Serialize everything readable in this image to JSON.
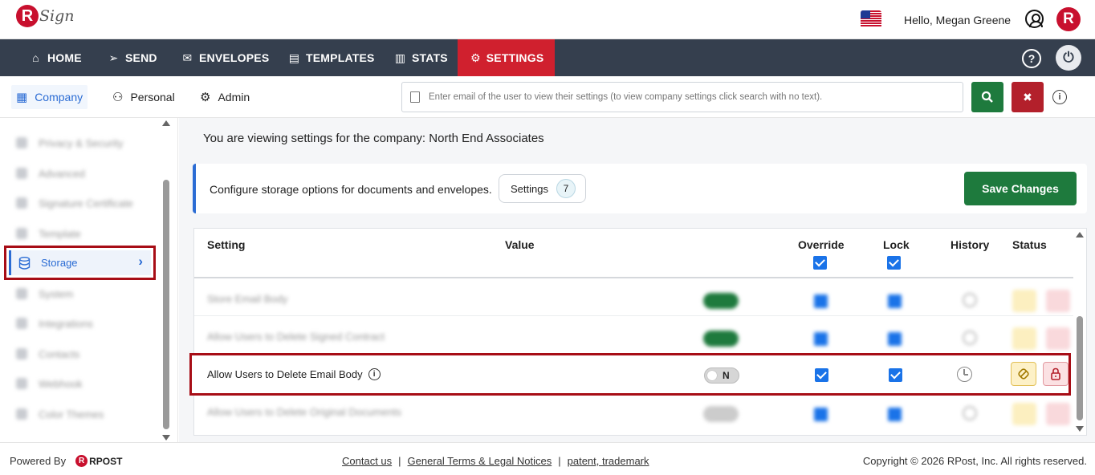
{
  "app": {
    "logo_letter": "R",
    "logo_text": "Sign"
  },
  "header": {
    "greeting": "Hello, Megan Greene",
    "brand_letter": "R"
  },
  "nav": {
    "items": [
      {
        "label": "HOME",
        "icon": "home-icon"
      },
      {
        "label": "SEND",
        "icon": "send-icon"
      },
      {
        "label": "ENVELOPES",
        "icon": "envelope-icon"
      },
      {
        "label": "TEMPLATES",
        "icon": "template-icon"
      },
      {
        "label": "STATS",
        "icon": "bar-chart-icon"
      },
      {
        "label": "SETTINGS",
        "icon": "gear-icon",
        "active": true
      }
    ],
    "help_label": "?",
    "active_color": "#d0202e",
    "bar_color": "#353f4e"
  },
  "subnav": {
    "tabs": [
      {
        "label": "Company",
        "icon": "company-icon",
        "active": true
      },
      {
        "label": "Personal",
        "icon": "person-icon"
      },
      {
        "label": "Admin",
        "icon": "admin-icon"
      }
    ],
    "search_placeholder": "Enter email of the user to view their settings (to view company settings click search with no text).",
    "search_value": ""
  },
  "sidebar": {
    "active_item": {
      "label": "Storage",
      "icon": "database-icon"
    }
  },
  "main": {
    "viewing_text": "You are viewing settings for the company: North End Associates",
    "info_text": "Configure storage options for documents and envelopes.",
    "settings_pill_label": "Settings",
    "settings_count": "7",
    "save_button": "Save Changes",
    "table": {
      "headers": {
        "setting": "Setting",
        "value": "Value",
        "override": "Override",
        "lock": "Lock",
        "history": "History",
        "status": "Status"
      },
      "highlight_row": {
        "label": "Allow Users to Delete Email Body",
        "toggle_value": "N",
        "override_checked": true,
        "lock_checked": true
      }
    }
  },
  "footer": {
    "powered_by": "Powered By",
    "rpost_text": "RPOST",
    "rpost_letter": "R",
    "links": [
      "Contact us",
      "General Terms & Legal Notices",
      "patent, trademark"
    ],
    "separator": "|",
    "copyright": "Copyright © 2026 RPost, Inc. All rights reserved."
  },
  "colors": {
    "brand_red": "#c8102e",
    "save_green": "#1e7a3d",
    "highlight_border": "#a70d16",
    "accent_blue": "#2b6cd4"
  }
}
